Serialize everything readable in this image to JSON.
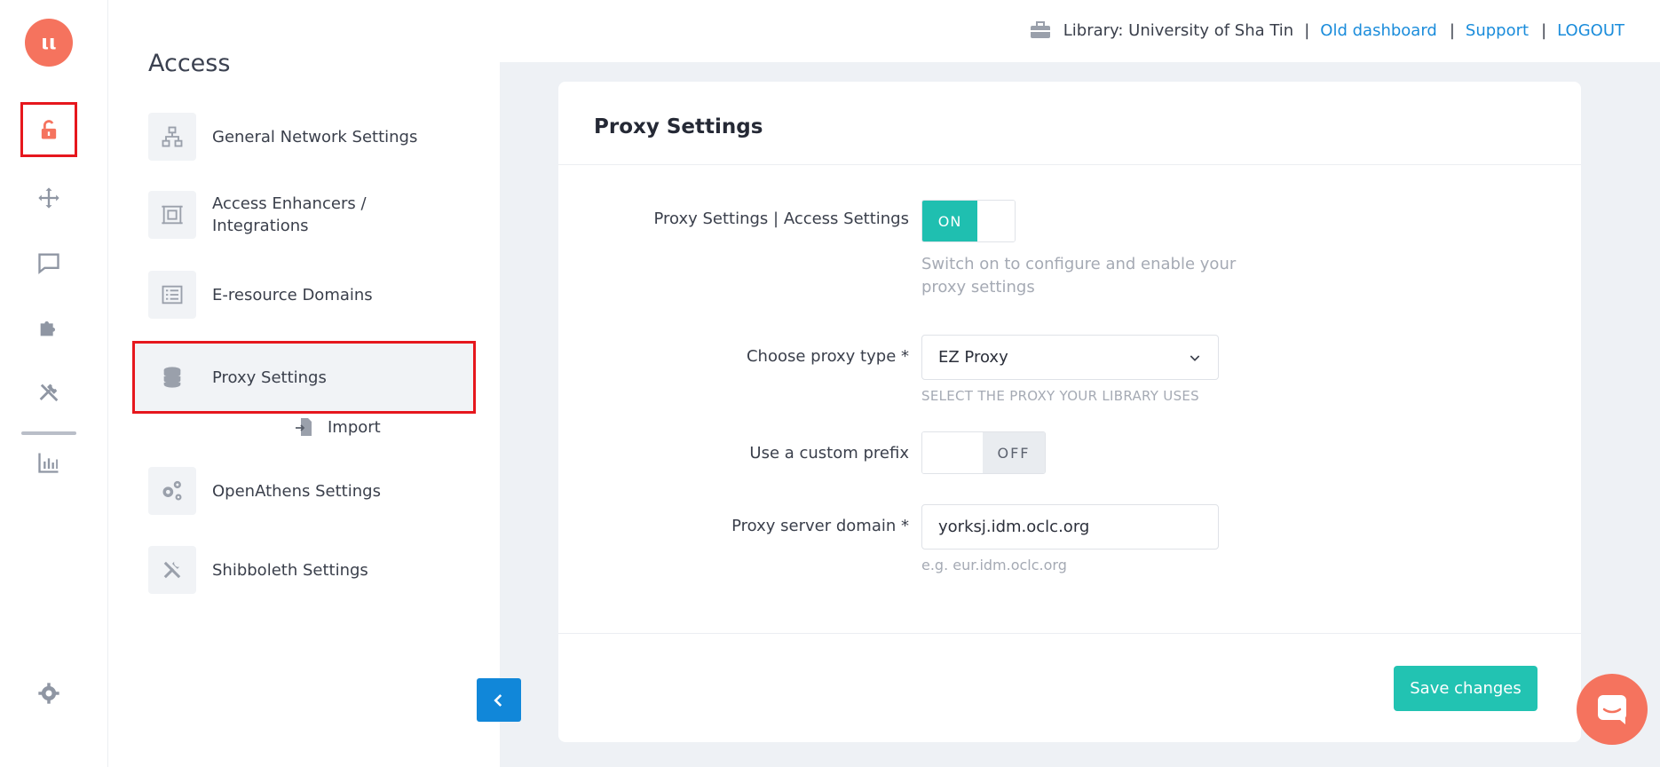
{
  "logo": {
    "letters": "ιι"
  },
  "topbar": {
    "library_label": "Library: University of Sha Tin",
    "old_dashboard": "Old dashboard",
    "support": "Support",
    "logout": "LOGOUT",
    "sep": "|"
  },
  "subnav": {
    "title": "Access",
    "items": [
      {
        "label": "General Network Settings"
      },
      {
        "label": "Access Enhancers / Integrations"
      },
      {
        "label": "E-resource Domains"
      },
      {
        "label": "Proxy Settings"
      },
      {
        "label": "Import"
      },
      {
        "label": "OpenAthens Settings"
      },
      {
        "label": "Shibboleth Settings"
      }
    ]
  },
  "card": {
    "title": "Proxy Settings",
    "access_label": "Proxy Settings | Access Settings",
    "access_toggle": "ON",
    "access_help": "Switch on to configure and enable your proxy settings",
    "proxy_type_label": "Choose proxy type *",
    "proxy_type_value": "EZ Proxy",
    "proxy_type_help": "SELECT THE PROXY YOUR LIBRARY USES",
    "custom_prefix_label": "Use a custom prefix",
    "custom_prefix_toggle": "OFF",
    "domain_label": "Proxy server domain *",
    "domain_value": "yorksj.idm.oclc.org",
    "domain_help": "e.g. eur.idm.oclc.org",
    "save_label": "Save changes"
  },
  "colors": {
    "accent": "#f5735e",
    "teal": "#22c3b2",
    "link": "#1a8cdb",
    "highlight": "#e6171d"
  }
}
